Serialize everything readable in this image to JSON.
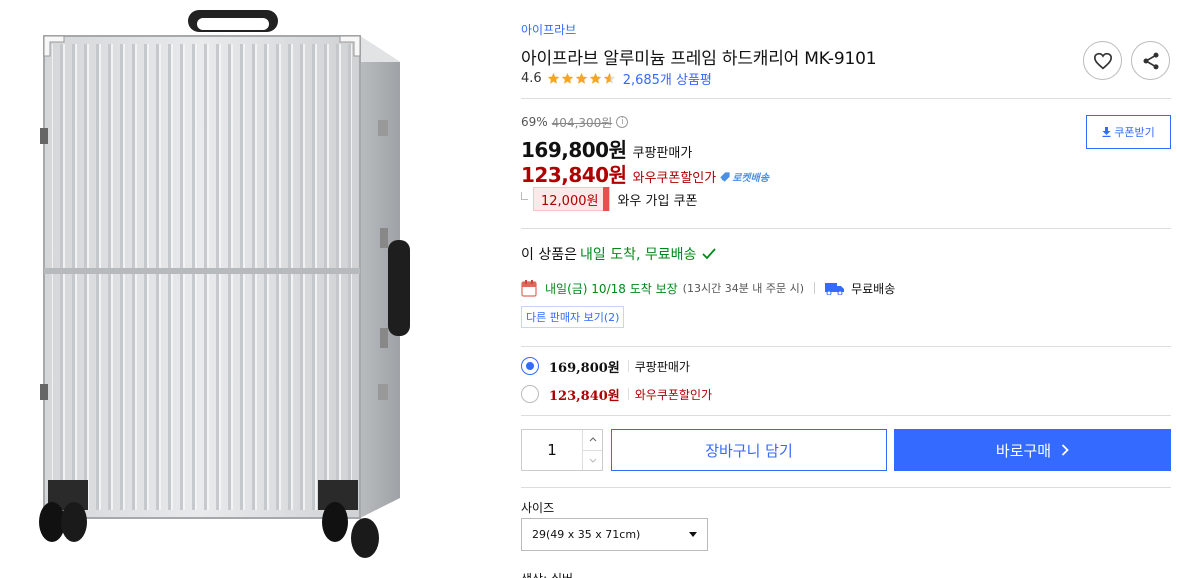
{
  "product": {
    "brand": "아이프라브",
    "title": "아이프라브 알루미늄 프레임 하드캐리어 MK-9101",
    "rating": "4.6",
    "rating_value": 4.6,
    "review_count": "2,685개 상품평"
  },
  "actions": {
    "wish_icon": "heart-icon",
    "share_icon": "share-icon",
    "coupon_download": "쿠폰받기"
  },
  "price": {
    "discount_rate": "69%",
    "original_price": "404,300원",
    "sale_price": "169,800원",
    "sale_label": "쿠팡판매가",
    "coupon_price": "123,840원",
    "coupon_label": "와우쿠폰할인가",
    "rocket_badge": "로켓배송",
    "coupon_tag_amount": "12,000원",
    "coupon_tag_label": "와우 가입 쿠폰"
  },
  "delivery": {
    "headline_prefix": "이 상품은",
    "headline_highlight": "내일 도착, 무료배송",
    "arrival": "내일(금) 10/18 도착 보장",
    "arrival_note": "(13시간 34분 내 주문 시)",
    "free_shipping": "무료배송",
    "other_sellers": "다른 판매자 보기(2)"
  },
  "options": [
    {
      "price": "169,800원",
      "label": "쿠팡판매가",
      "selected": true,
      "color": "#111111"
    },
    {
      "price": "123,840원",
      "label": "와우쿠폰할인가",
      "selected": false,
      "color": "#ae0000"
    }
  ],
  "purchase": {
    "quantity": "1",
    "cart_label": "장바구니 담기",
    "buy_label": "바로구매",
    "buy_chevron": "›"
  },
  "size": {
    "label": "사이즈",
    "selected": "29(49 x 35 x 71cm)"
  },
  "color_label": "색상: 실버",
  "colors": {
    "accent": "#346aff",
    "coupon_red": "#ae0000",
    "delivery_green": "#00891a"
  }
}
